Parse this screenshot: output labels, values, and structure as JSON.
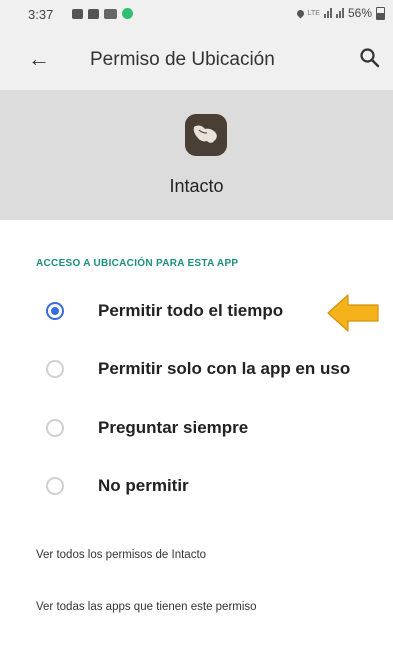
{
  "status_bar": {
    "time": "3:37",
    "network_label": "LTE",
    "battery": "56%",
    "notification_icons": [
      "gallery-icon",
      "chat-icon",
      "mail-icon",
      "app-icon"
    ]
  },
  "app_bar": {
    "title": "Permiso de Ubicación",
    "back_icon": "arrow-back-icon",
    "search_icon": "search-icon"
  },
  "app_header": {
    "app_name": "Intacto",
    "icon": "map-icon"
  },
  "section_label": "ACCESO A UBICACIÓN PARA ESTA APP",
  "options": [
    {
      "label": "Permitir todo el tiempo",
      "selected": true
    },
    {
      "label": "Permitir solo con la app en uso",
      "selected": false
    },
    {
      "label": "Preguntar siempre",
      "selected": false
    },
    {
      "label": "No permitir",
      "selected": false
    }
  ],
  "links": {
    "view_all_permissions": "Ver todos los permisos de Intacto",
    "view_all_apps": "Ver todas las apps que tienen este permiso"
  },
  "colors": {
    "accent": "#3a6be0",
    "section_label": "#1a8f7d",
    "arrow": "#f5b21a"
  }
}
